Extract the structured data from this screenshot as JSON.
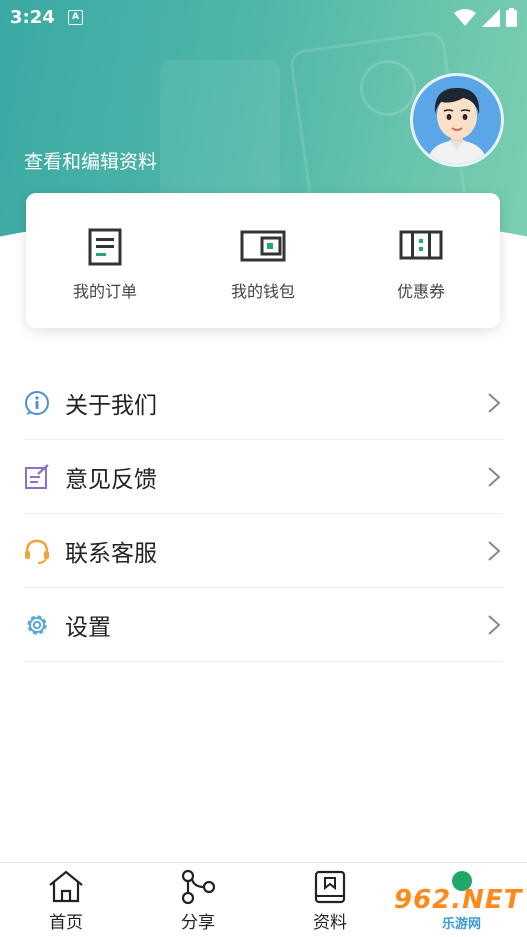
{
  "status_bar": {
    "time": "3:24",
    "notification_icon_letter": "A"
  },
  "profile": {
    "edit_label": "查看和编辑资料"
  },
  "quick_actions": [
    {
      "label": "我的订单",
      "icon": "order-icon"
    },
    {
      "label": "我的钱包",
      "icon": "wallet-icon"
    },
    {
      "label": "优惠券",
      "icon": "coupon-icon"
    }
  ],
  "menu": [
    {
      "label": "关于我们",
      "icon": "info-icon",
      "color": "#4a8fd6"
    },
    {
      "label": "意见反馈",
      "icon": "feedback-icon",
      "color": "#8e6fd0"
    },
    {
      "label": "联系客服",
      "icon": "headset-icon",
      "color": "#f2a23a"
    },
    {
      "label": "设置",
      "icon": "gear-icon",
      "color": "#5aa8d8"
    }
  ],
  "tabbar": [
    {
      "label": "首页",
      "icon": "home-icon"
    },
    {
      "label": "分享",
      "icon": "share-icon"
    },
    {
      "label": "资料",
      "icon": "book-icon"
    }
  ],
  "watermark": {
    "text": "962.NET",
    "sub": "乐游网"
  },
  "colors": {
    "header_start": "#3aa9a4",
    "header_end": "#7ccfb1",
    "accent": "#2aa66b"
  }
}
